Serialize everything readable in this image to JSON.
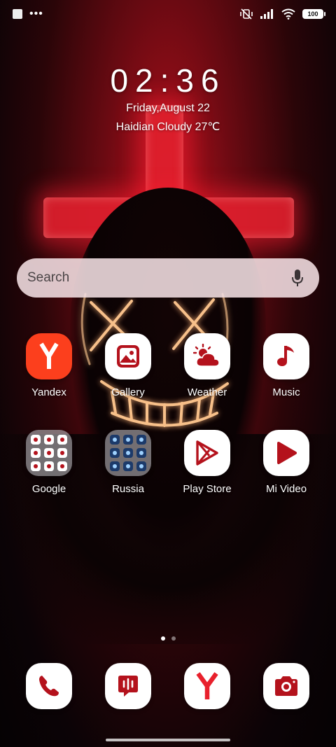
{
  "status_bar": {
    "battery": "100",
    "left_icons": [
      "screenshot-icon",
      "more-dots-icon"
    ],
    "right_icons": [
      "vibrate-off-icon",
      "signal-icon",
      "wifi-icon",
      "battery-icon"
    ]
  },
  "lock_widget": {
    "time": "02:36",
    "date": "Friday,August 22",
    "weather": "Haidian Cloudy 27℃"
  },
  "search": {
    "placeholder": "Search"
  },
  "apps_row1": [
    {
      "label": "Yandex"
    },
    {
      "label": "Gallery"
    },
    {
      "label": "Weather"
    },
    {
      "label": "Music"
    }
  ],
  "apps_row2": [
    {
      "label": "Google"
    },
    {
      "label": "Russia"
    },
    {
      "label": "Play Store"
    },
    {
      "label": "Mi Video"
    }
  ],
  "dock": [
    "phone-icon",
    "messages-icon",
    "yandex-browser-icon",
    "camera-icon"
  ],
  "colors": {
    "accent": "#b4121c",
    "yandex": "#fc3f1d",
    "search_bg": "#f4e0e4"
  }
}
